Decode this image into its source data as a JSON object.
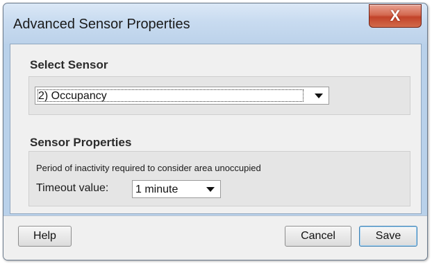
{
  "window": {
    "title": "Advanced Sensor Properties",
    "close_glyph": "X"
  },
  "select_sensor": {
    "heading": "Select Sensor",
    "selected": "2) Occupancy"
  },
  "sensor_properties": {
    "heading": "Sensor Properties",
    "description": "Period of inactivity required to consider area unoccupied",
    "timeout_label": "Timeout value:",
    "timeout_selected": "1 minute"
  },
  "footer": {
    "help_label": "Help",
    "cancel_label": "Cancel",
    "save_label": "Save"
  },
  "icons": {
    "dropdown": "chevron-down-icon",
    "close": "close-icon"
  },
  "colors": {
    "frame": "#b9d1ea",
    "close_button": "#c2432a",
    "default_button_border": "#3c7fb1"
  }
}
